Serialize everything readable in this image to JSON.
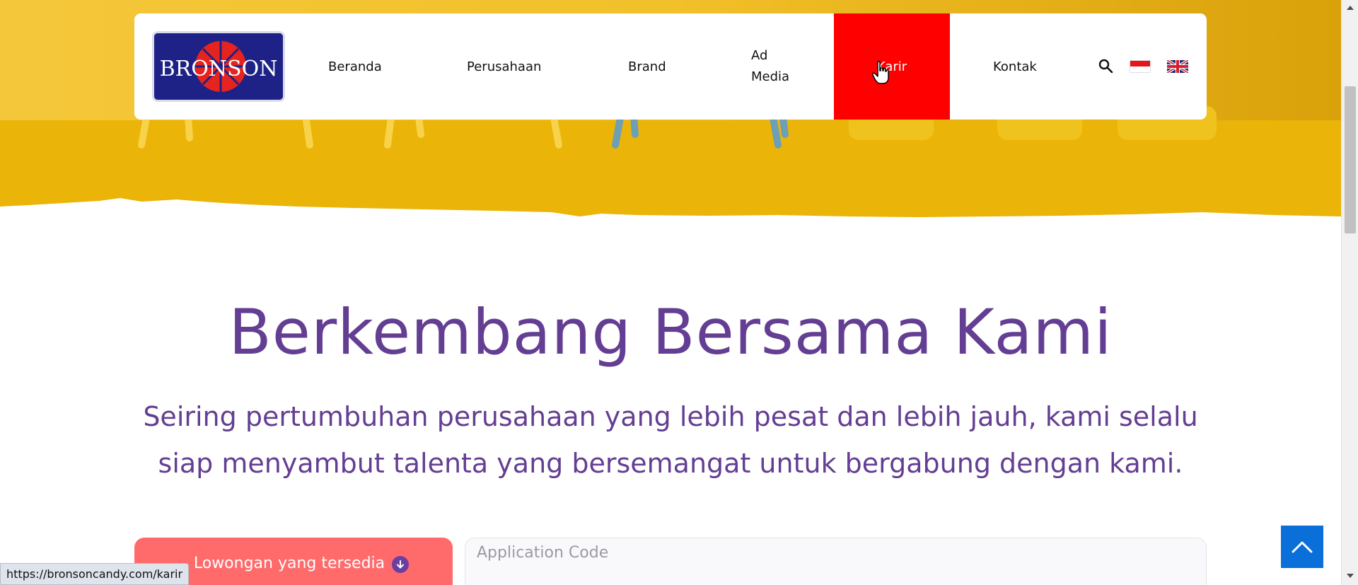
{
  "nav": {
    "logo_text": "BRONSON",
    "items": [
      {
        "label": "Beranda"
      },
      {
        "label": "Perusahaan"
      },
      {
        "label": "Brand"
      },
      {
        "label": "Ad Media"
      },
      {
        "label": "Karir"
      },
      {
        "label": "Kontak"
      }
    ],
    "active_item": "Karir",
    "active_color": "#ff0000",
    "search_icon": "search-icon",
    "languages": [
      "id-flag-icon",
      "uk-flag-icon"
    ]
  },
  "hero": {
    "background_color": "#f0b400"
  },
  "main": {
    "headline": "Berkembang Bersama Kami",
    "subtext": "Seiring pertumbuhan perusahaan yang lebih pesat dan lebih jauh, kami selalu siap menyambut talenta yang bersemangat untuk bergabung dengan kami.",
    "text_color": "#643e93"
  },
  "actions": {
    "vacancy_label": "Lowongan yang tersedia",
    "vacancy_color": "#ff6b6b",
    "app_code_placeholder": "Application Code"
  },
  "status_bar": {
    "url": "https://bronsoncandy.com/karir"
  },
  "back_to_top": {
    "color": "#0a6fd8",
    "icon": "chevron-up-icon"
  }
}
